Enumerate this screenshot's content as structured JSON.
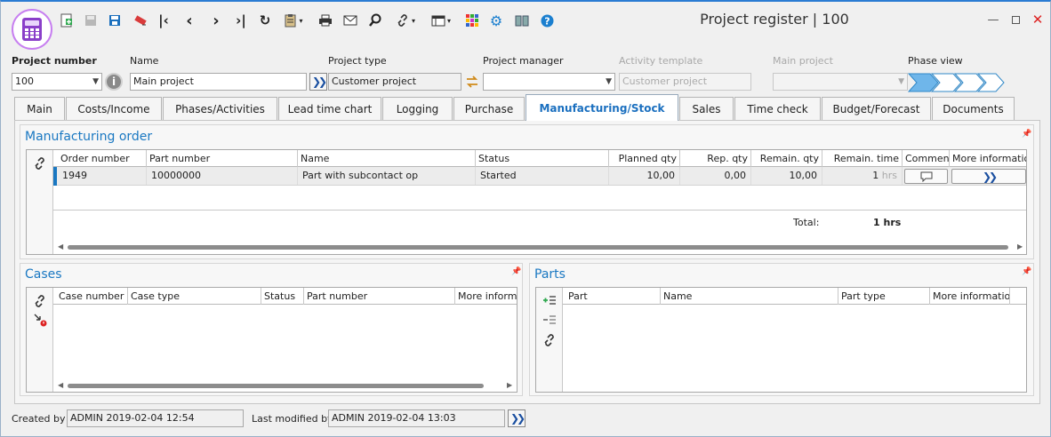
{
  "window": {
    "title": "Project register | 100"
  },
  "toolbar": {
    "icons": [
      "new-icon",
      "save-icon",
      "save-close-icon",
      "delete-icon",
      "first-icon",
      "previous-icon",
      "next-icon",
      "last-icon",
      "refresh-icon",
      "clipboard-icon",
      "print-icon",
      "email-icon",
      "search-icon",
      "link-icon",
      "layout-icon",
      "color-grid-icon",
      "settings-icon",
      "book-icon",
      "help-icon"
    ]
  },
  "header": {
    "project_number_label": "Project number",
    "project_number_value": "100",
    "name_label": "Name",
    "name_value": "Main project",
    "project_type_label": "Project type",
    "project_type_value": "Customer project",
    "project_manager_label": "Project manager",
    "project_manager_value": "",
    "activity_template_label": "Activity template",
    "activity_template_value": "Customer project",
    "main_project_label": "Main project",
    "main_project_value": "",
    "phase_view_label": "Phase view"
  },
  "tabs": [
    {
      "label": "Main"
    },
    {
      "label": "Costs/Income"
    },
    {
      "label": "Phases/Activities"
    },
    {
      "label": "Lead time chart"
    },
    {
      "label": "Logging"
    },
    {
      "label": "Purchase"
    },
    {
      "label": "Manufacturing/Stock"
    },
    {
      "label": "Sales"
    },
    {
      "label": "Time check"
    },
    {
      "label": "Budget/Forecast"
    },
    {
      "label": "Documents"
    }
  ],
  "manufacturing": {
    "title": "Manufacturing order",
    "columns": [
      "Order number",
      "Part number",
      "Name",
      "Status",
      "Planned qty",
      "Rep. qty",
      "Remain. qty",
      "Remain. time",
      "Comment",
      "More information"
    ],
    "row": {
      "order_number": "1949",
      "part_number": "10000000",
      "name": "Part with subcontact op",
      "status": "Started",
      "planned_qty": "10,00",
      "rep_qty": "0,00",
      "remain_qty": "10,00",
      "remain_time": "1",
      "remain_time_unit": "hrs"
    },
    "total_label": "Total:",
    "total_value": "1 hrs"
  },
  "cases": {
    "title": "Cases",
    "columns": [
      "Case number",
      "Case type",
      "Status",
      "Part number",
      "More informa"
    ]
  },
  "parts": {
    "title": "Parts",
    "columns": [
      "Part",
      "Name",
      "Part type",
      "More information"
    ]
  },
  "footer": {
    "created_by_label": "Created by",
    "created_by_value": "ADMIN 2019-02-04 12:54",
    "last_modified_label": "Last modified by",
    "last_modified_value": "ADMIN 2019-02-04 13:03"
  },
  "colors": {
    "accent": "#1a78c2",
    "title_bar": "#2b7cd3",
    "app_icon": "#8a3fc9"
  }
}
